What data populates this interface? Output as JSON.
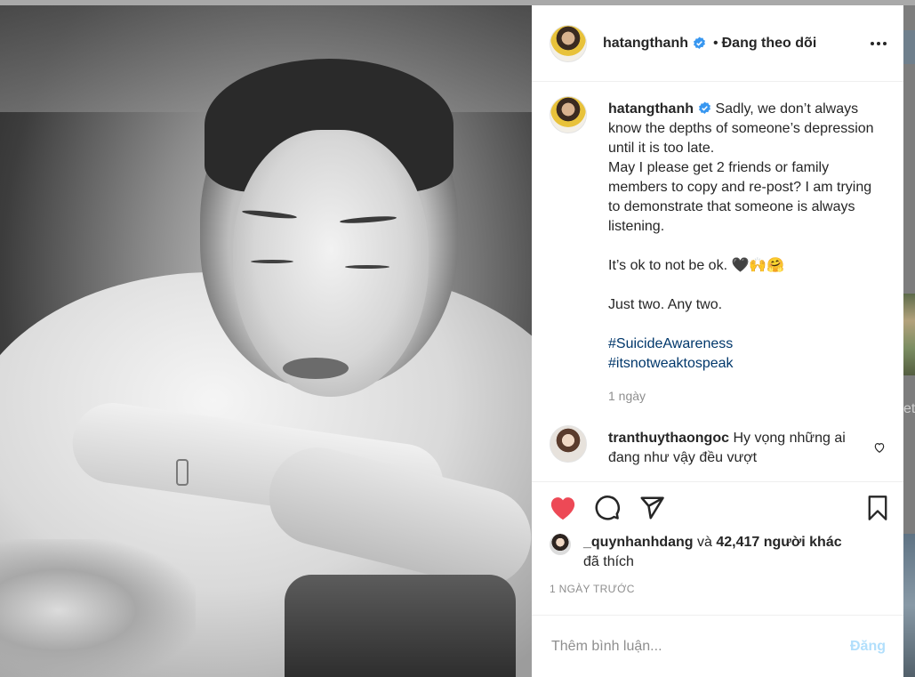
{
  "post": {
    "username": "hatangthanh",
    "follow_status": "Đang theo dõi",
    "separator": "•",
    "caption": {
      "username": "hatangthanh",
      "text": " Sadly, we don’t always know the depths of someone’s depression until it is too late.",
      "line2": "May I please get 2 friends or family members to copy and re-post? I am trying to demonstrate that someone is always listening.",
      "line3": "It’s ok to not be ok. 🖤🙌🤗",
      "line4": "Just two. Any two.",
      "hashtags": [
        "#SuicideAwareness",
        "#itsnotweaktospeak"
      ],
      "time": "1 ngày"
    },
    "comments": [
      {
        "username": "tranthuythaongoc",
        "text": " Hy vọng những ai đang như vậy đều vượt"
      }
    ],
    "likes": {
      "user": "_quynhanhdang",
      "connector": " và ",
      "count_text": "42,417 người khác",
      "suffix": "đã thích"
    },
    "posted_time": "1 NGÀY TRƯỚC",
    "add_comment": {
      "placeholder": "Thêm bình luận...",
      "post_label": "Đăng"
    }
  },
  "colors": {
    "like_red": "#ed4956",
    "verified_blue": "#3897f0",
    "hashtag": "#00376b",
    "muted": "#8e8e8e",
    "post_btn_disabled": "#b2dffc"
  },
  "icons": [
    "more-icon",
    "verified-icon",
    "heart-icon",
    "comment-icon",
    "share-icon",
    "bookmark-icon",
    "heart-outline-icon"
  ]
}
